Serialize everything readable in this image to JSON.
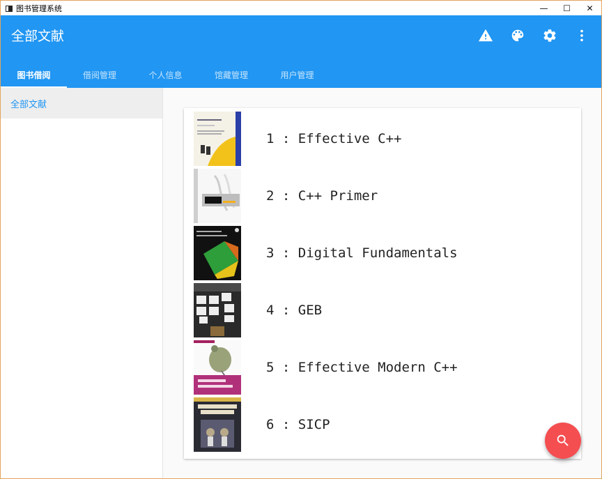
{
  "window": {
    "title": "图书管理系统",
    "controls": {
      "minimize": "—",
      "maximize": "☐",
      "close": "✕"
    }
  },
  "appbar": {
    "title": "全部文献",
    "actions": [
      "warning-icon",
      "palette-icon",
      "settings-icon",
      "more-vert-icon"
    ],
    "accent_color": "#2196f3"
  },
  "tabs": [
    {
      "label": "图书借阅",
      "active": true
    },
    {
      "label": "借阅管理",
      "active": false
    },
    {
      "label": "个人信息",
      "active": false
    },
    {
      "label": "馆藏管理",
      "active": false
    },
    {
      "label": "用户管理",
      "active": false
    }
  ],
  "sidebar": {
    "items": [
      {
        "label": "全部文献",
        "selected": true
      }
    ]
  },
  "books": [
    {
      "label": "1 : Effective C++",
      "cover": "effective-cpp-cover"
    },
    {
      "label": "2 : C++ Primer",
      "cover": "cpp-primer-cover"
    },
    {
      "label": "3 : Digital Fundamentals",
      "cover": "digital-fundamentals-cover"
    },
    {
      "label": "4 : GEB",
      "cover": "geb-cover"
    },
    {
      "label": "5 : Effective Modern C++",
      "cover": "effective-modern-cpp-cover"
    },
    {
      "label": "6 : SICP",
      "cover": "sicp-cover"
    }
  ],
  "fab": {
    "icon": "search-icon",
    "color": "#f44e51"
  }
}
